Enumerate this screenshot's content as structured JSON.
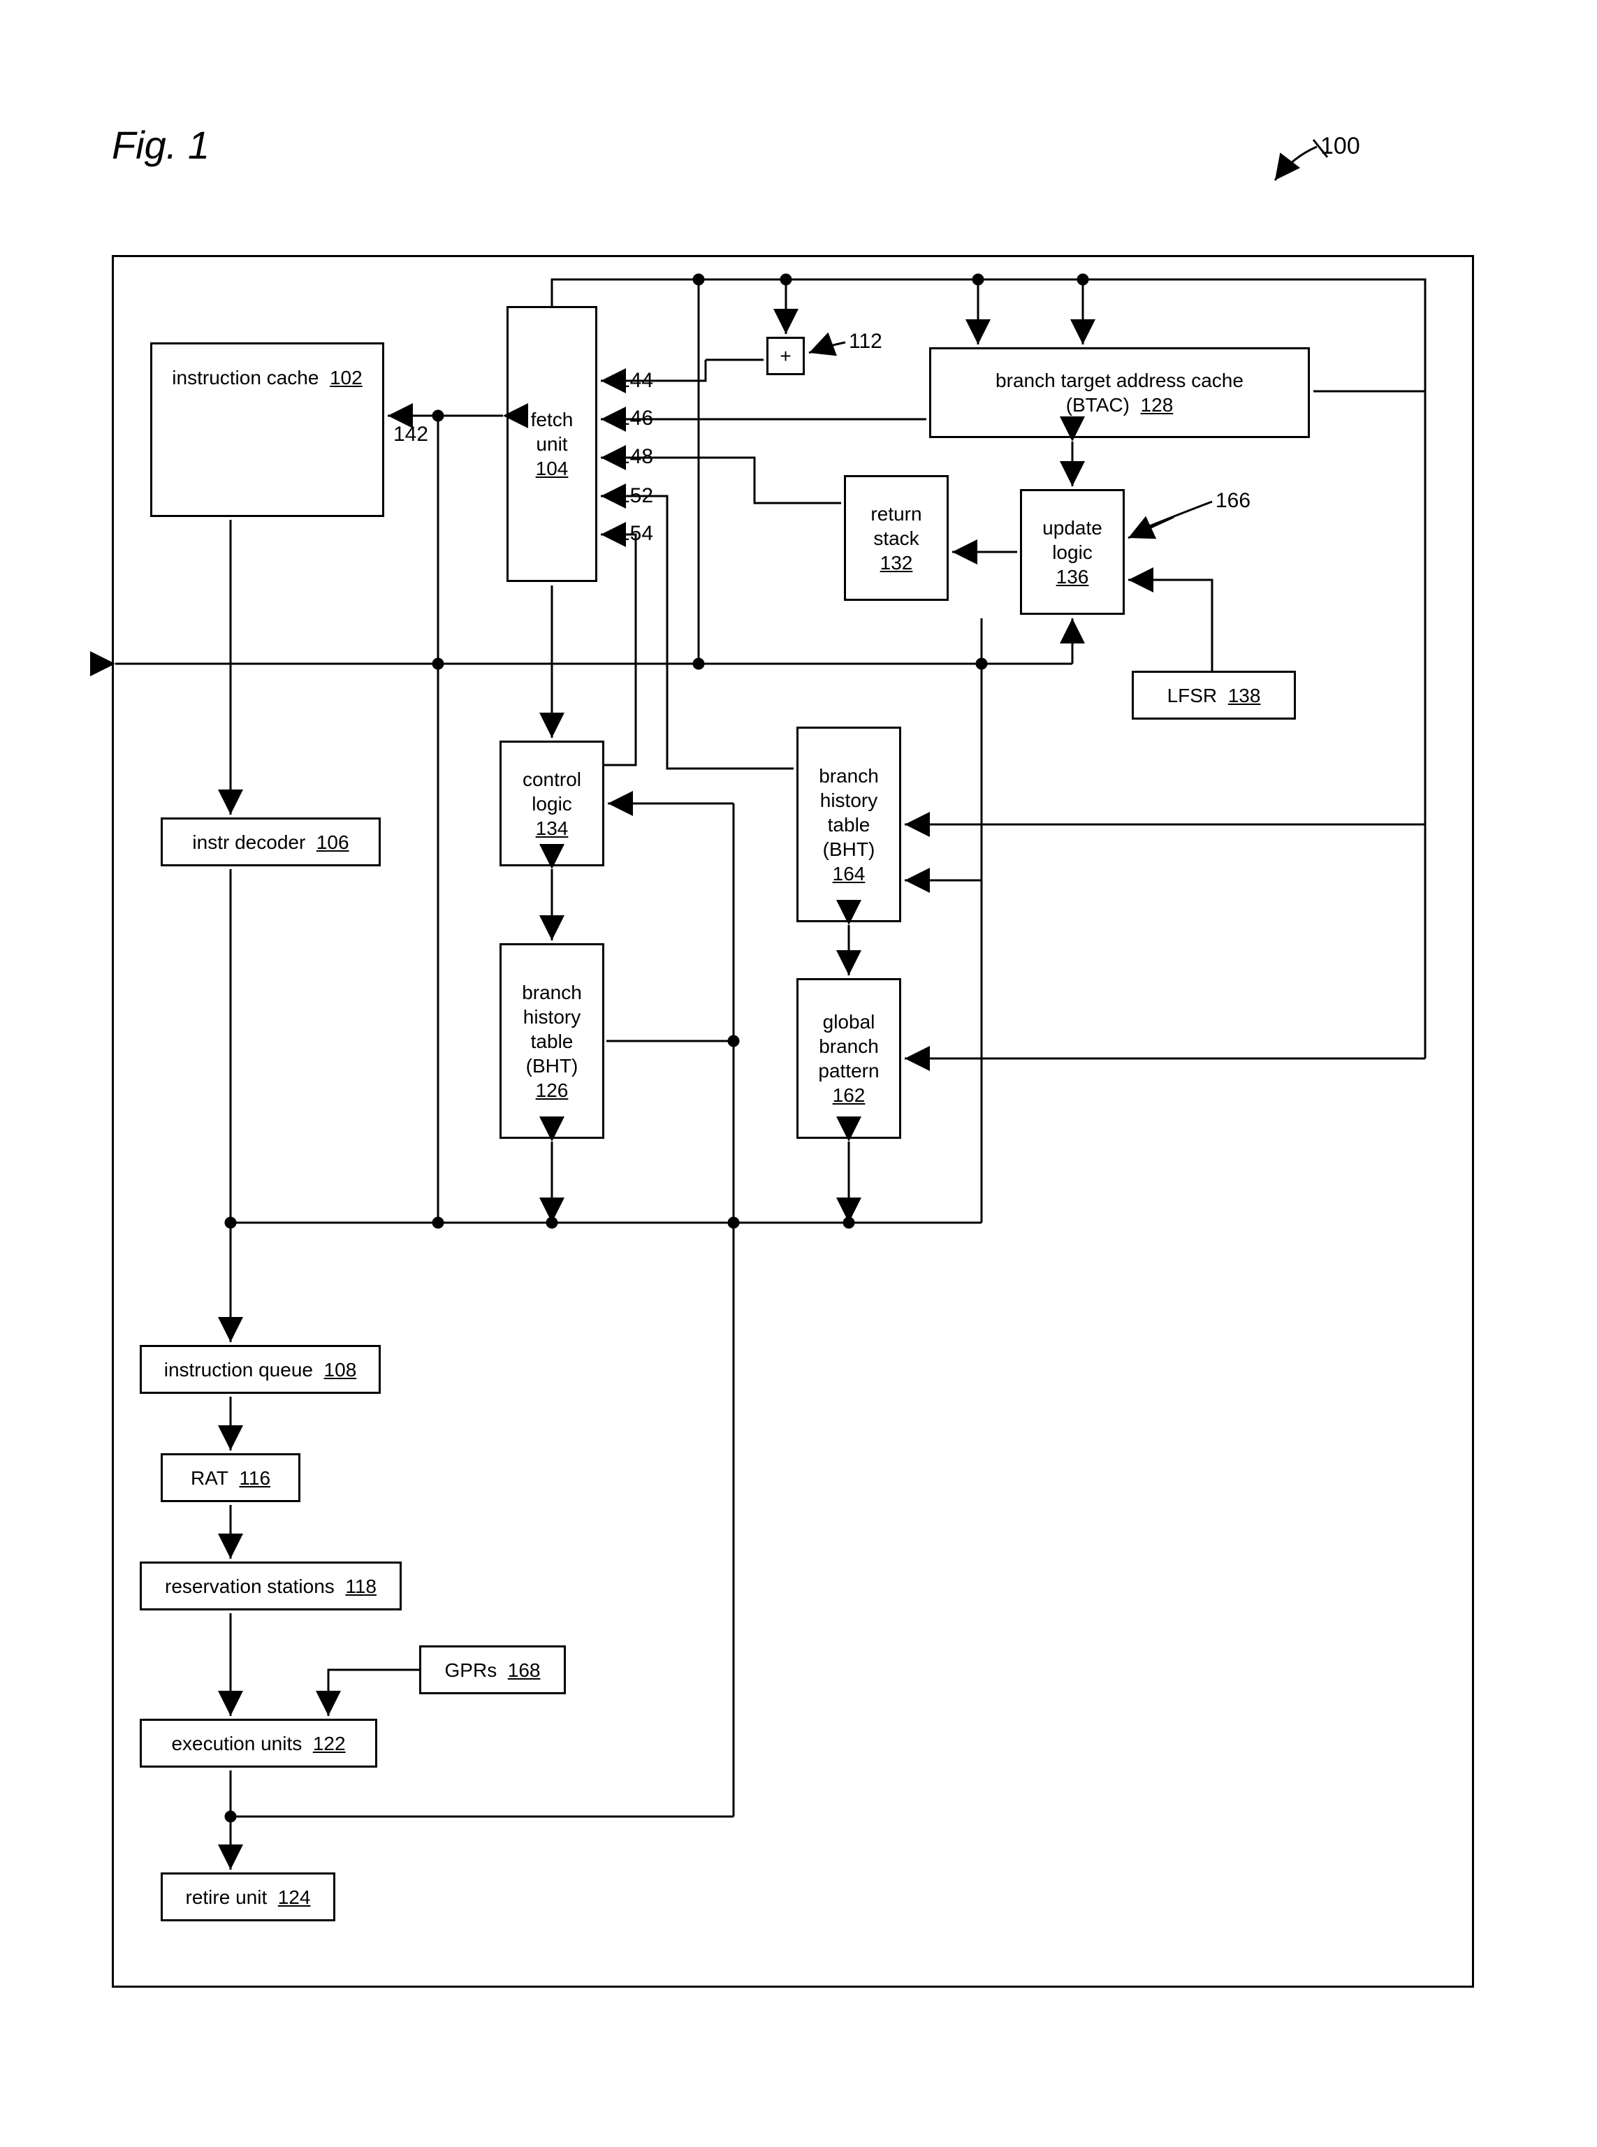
{
  "figure_label": "Fig. 1",
  "ref100": "100",
  "boxes": {
    "icache": {
      "text": "instruction cache",
      "ref": "102"
    },
    "fetch": {
      "line1": "fetch",
      "line2": "unit",
      "ref": "104"
    },
    "adder": {
      "text": "+"
    },
    "btac": {
      "line1": "branch target address cache",
      "line2": "(BTAC)",
      "ref": "128"
    },
    "rstack": {
      "line1": "return",
      "line2": "stack",
      "ref": "132"
    },
    "ulogic": {
      "line1": "update",
      "line2": "logic",
      "ref": "136"
    },
    "lfsr": {
      "text": "LFSR",
      "ref": "138"
    },
    "clogic": {
      "line1": "control",
      "line2": "logic",
      "ref": "134"
    },
    "bht126": {
      "line1": "branch",
      "line2": "history",
      "line3": "table",
      "line4": "(BHT)",
      "ref": "126"
    },
    "bht164": {
      "line1": "branch",
      "line2": "history",
      "line3": "table",
      "line4": "(BHT)",
      "ref": "164"
    },
    "gbp": {
      "line1": "global",
      "line2": "branch",
      "line3": "pattern",
      "ref": "162"
    },
    "idec": {
      "text": "instr decoder",
      "ref": "106"
    },
    "iq": {
      "text": "instruction queue",
      "ref": "108"
    },
    "rat": {
      "text": "RAT",
      "ref": "116"
    },
    "rs": {
      "text": "reservation stations",
      "ref": "118"
    },
    "gprs": {
      "text": "GPRs",
      "ref": "168"
    },
    "exu": {
      "text": "execution units",
      "ref": "122"
    },
    "retire": {
      "text": "retire unit",
      "ref": "124"
    }
  },
  "ann": {
    "a112": "112",
    "a166": "166",
    "a142": "142",
    "a144": "144",
    "a146": "146",
    "a148": "148",
    "a152": "152",
    "a154": "154"
  }
}
